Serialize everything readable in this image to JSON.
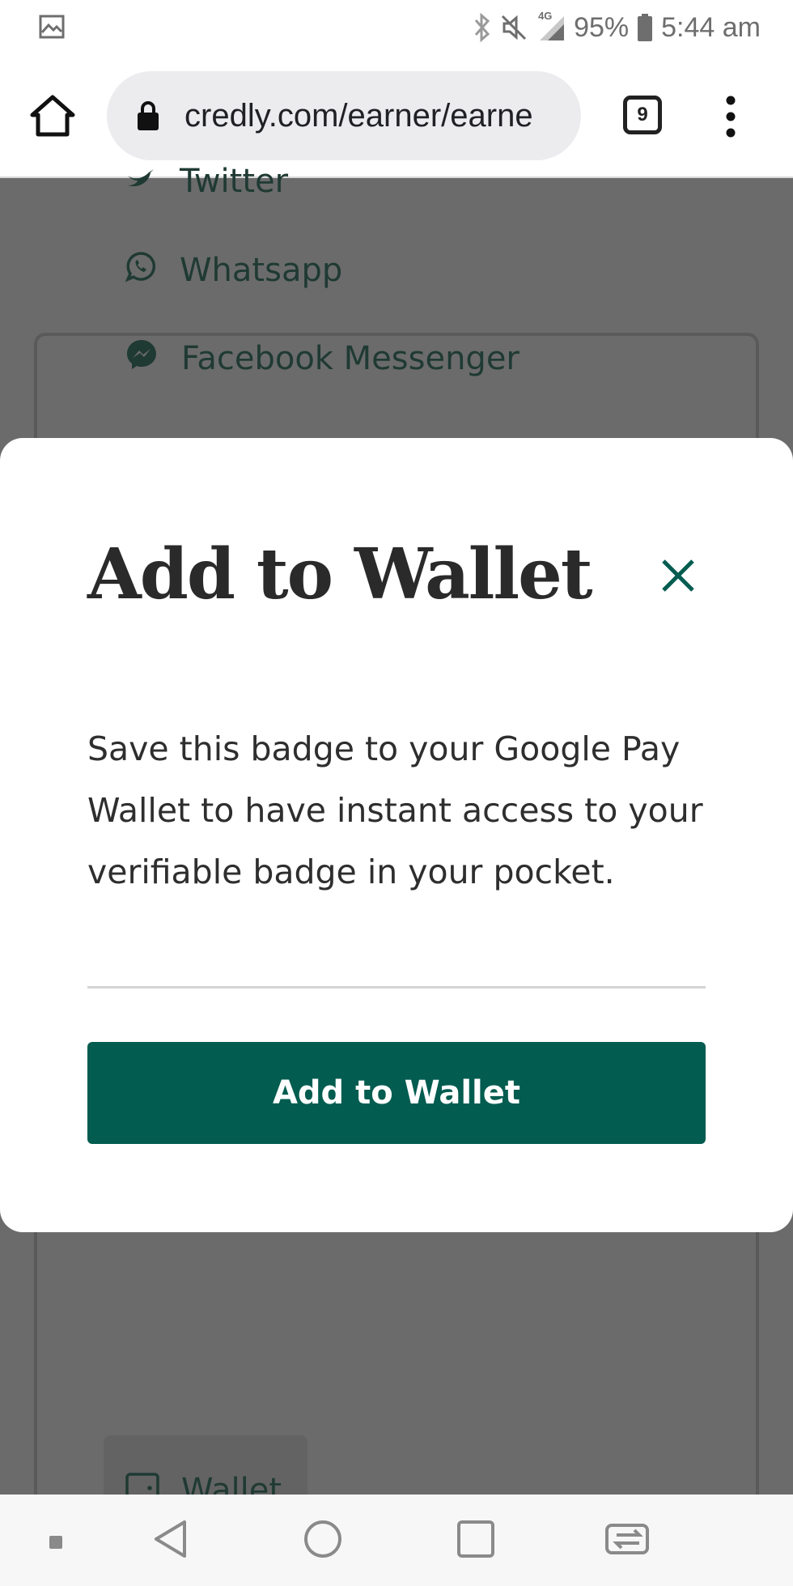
{
  "status_bar": {
    "battery_percent": "95%",
    "time": "5:44 am",
    "network": "4G",
    "icons": [
      "gallery-icon",
      "bluetooth-icon",
      "mute-icon",
      "signal-icon",
      "battery-icon"
    ]
  },
  "browser": {
    "url": "credly.com/earner/earne",
    "tab_count": "9",
    "icons": [
      "home-icon",
      "lock-icon",
      "tabs-icon",
      "overflow-menu-icon"
    ]
  },
  "background_page": {
    "share_items": [
      {
        "label": "Twitter",
        "icon": "twitter-icon"
      },
      {
        "label": "Whatsapp",
        "icon": "whatsapp-icon"
      },
      {
        "label": "Facebook Messenger",
        "icon": "messenger-icon"
      }
    ],
    "wallet_label": "Wallet"
  },
  "modal": {
    "title": "Add to Wallet",
    "body": "Save this badge to your Google Pay Wallet to have instant access to your verifiable badge in your pocket.",
    "button_label": "Add to Wallet",
    "accent_color": "#035c50"
  },
  "nav_bar": {
    "icons": [
      "recent-dot-icon",
      "back-icon",
      "home-circle-icon",
      "overview-icon",
      "switch-app-icon"
    ]
  }
}
